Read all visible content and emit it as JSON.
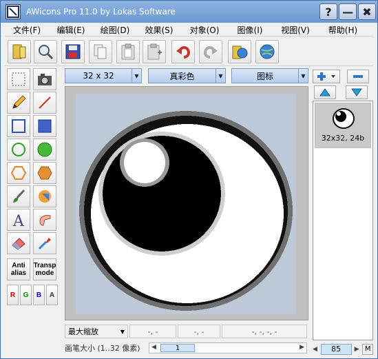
{
  "window": {
    "title": "AWicons Pro 11.0 by Lokas Software",
    "help_glyph": "?",
    "minimize_glyph": "—",
    "close_glyph": "✖"
  },
  "menu": [
    "文件(F)",
    "编辑(E)",
    "绘图(D)",
    "效果(S)",
    "对象(O)",
    "图像(I)",
    "视图(V)",
    "帮助(H)"
  ],
  "toolbar": {
    "icons": [
      "new-library-icon",
      "zoom-icon",
      "save-icon",
      "copy-icon",
      "paste-icon",
      "paste-new-icon",
      "undo-icon",
      "redo-icon",
      "open-library-icon",
      "web-icon"
    ]
  },
  "tools": {
    "anti_alias": [
      "Anti",
      "alias"
    ],
    "transp_mode": [
      "Transp",
      "mode"
    ],
    "channels": [
      "R",
      "G",
      "B",
      "A"
    ]
  },
  "format": {
    "size": "32 x 32",
    "colors": "真彩色",
    "type": "图标"
  },
  "status": {
    "zoom_mode": "最大缩放",
    "pos": "-, -",
    "color": "-, -",
    "rect": "-, -, -, -"
  },
  "brush": {
    "label": "画笔大小 (1..32 像素)",
    "value": "1"
  },
  "right": {
    "item_label": "32x32, 24b",
    "zoom": "85",
    "m_label": "M"
  },
  "colors": {
    "accent": "#6b97d2",
    "canvas_bg": "#bdc9d6"
  }
}
